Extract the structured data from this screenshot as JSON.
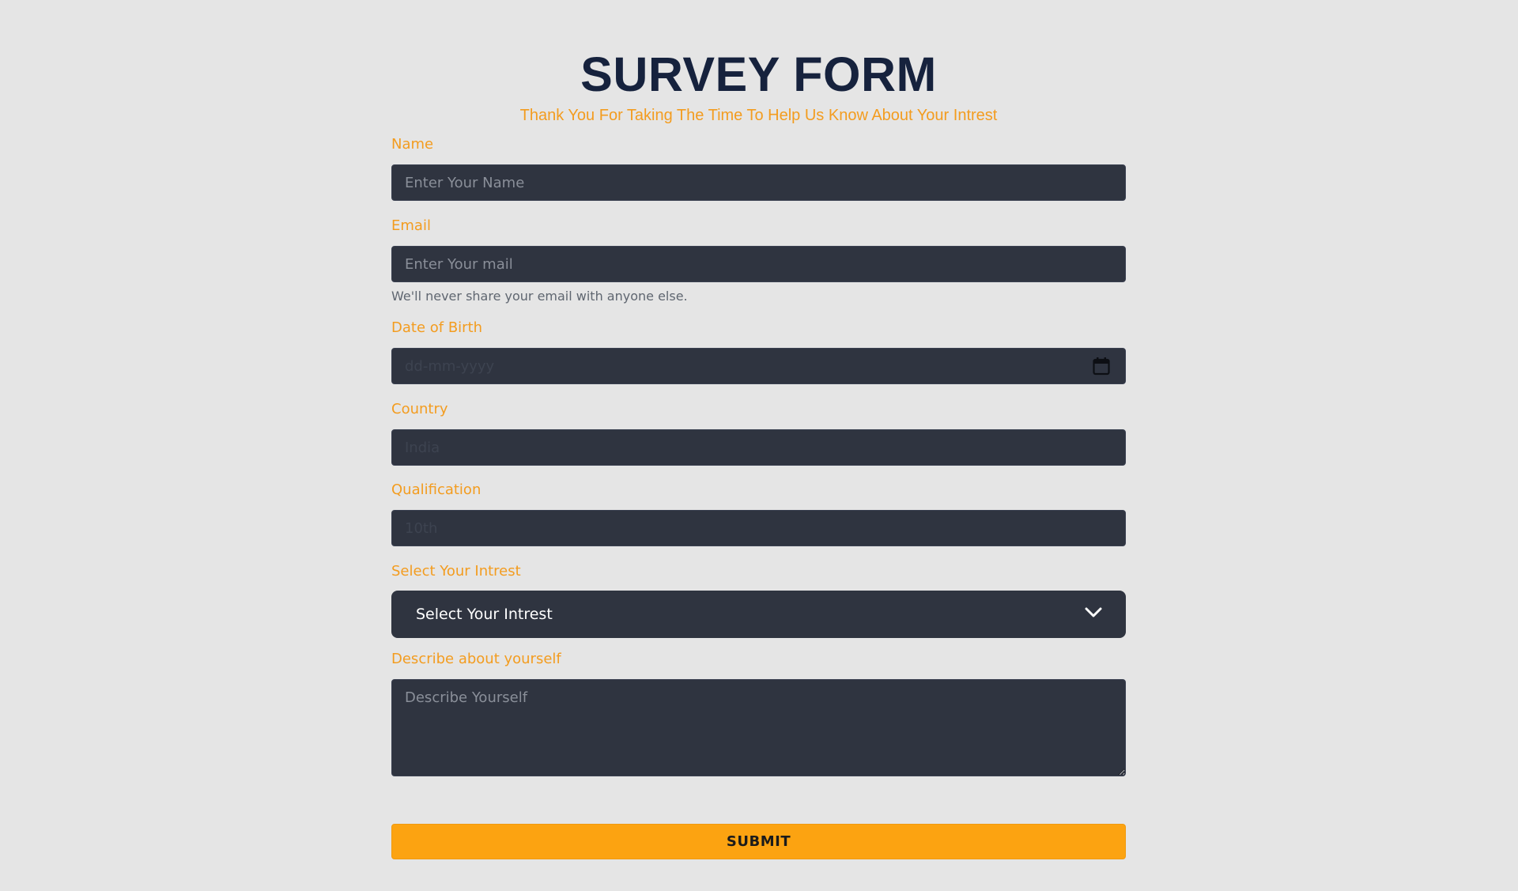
{
  "header": {
    "title": "SURVEY FORM",
    "subtitle": "Thank You For Taking The Time To Help Us Know About Your Intrest"
  },
  "form": {
    "name": {
      "label": "Name",
      "placeholder": "Enter Your Name",
      "value": ""
    },
    "email": {
      "label": "Email",
      "placeholder": "Enter Your mail",
      "value": "",
      "help": "We'll never share your email with anyone else."
    },
    "dob": {
      "label": "Date of Birth",
      "placeholder": "dd-mm-yyyy",
      "icon": "calendar-icon"
    },
    "country": {
      "label": "Country",
      "placeholder": "India",
      "value": ""
    },
    "qualification": {
      "label": "Qualification",
      "placeholder": "10th",
      "value": ""
    },
    "interest": {
      "label": "Select Your Intrest",
      "selected": "Select Your Intrest",
      "icon": "chevron-down-icon"
    },
    "about": {
      "label": "Describe about yourself",
      "placeholder": "Describe Yourself",
      "value": ""
    },
    "submit_label": "SUBMIT"
  },
  "colors": {
    "background": "#e5e5e5",
    "title": "#16223d",
    "accent": "#f39c1f",
    "field_bg": "#2f3440",
    "button": "#fca311"
  }
}
